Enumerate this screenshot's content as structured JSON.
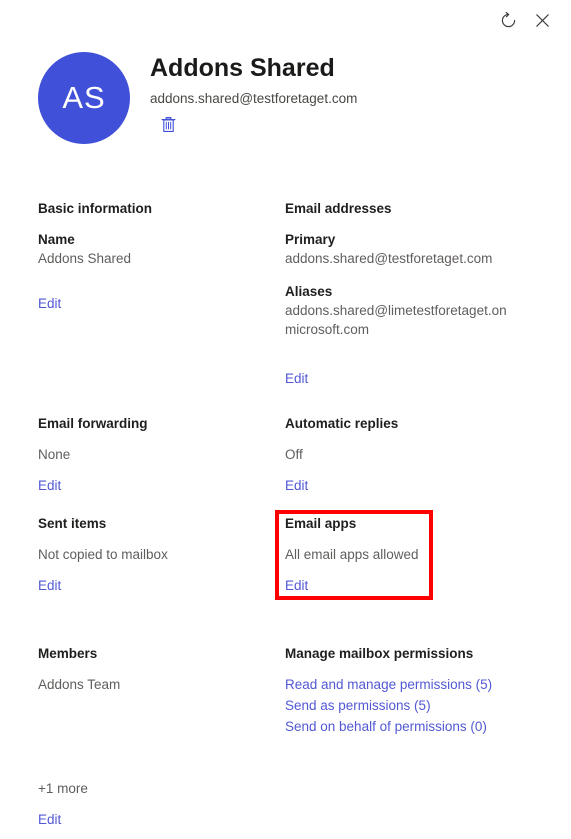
{
  "window": {
    "refresh_tooltip": "Refresh",
    "close_tooltip": "Close"
  },
  "header": {
    "avatar_initials": "AS",
    "display_name": "Addons Shared",
    "primary_email": "addons.shared@testforetaget.com",
    "delete_tooltip": "Delete"
  },
  "sections": {
    "basic_information": {
      "title": "Basic information",
      "name_label": "Name",
      "name_value": "Addons Shared",
      "edit_label": "Edit"
    },
    "email_addresses": {
      "title": "Email addresses",
      "primary_label": "Primary",
      "primary_value": "addons.shared@testforetaget.com",
      "aliases_label": "Aliases",
      "aliases_value_line1": "addons.shared@limetestforetaget.on",
      "aliases_value_line2": "microsoft.com",
      "edit_label": "Edit"
    },
    "email_forwarding": {
      "title": "Email forwarding",
      "value": "None",
      "edit_label": "Edit"
    },
    "automatic_replies": {
      "title": "Automatic replies",
      "value": "Off",
      "edit_label": "Edit"
    },
    "sent_items": {
      "title": "Sent items",
      "value": "Not copied to mailbox",
      "edit_label": "Edit"
    },
    "email_apps": {
      "title": "Email apps",
      "value": "All email apps allowed",
      "edit_label": "Edit",
      "highlight_color": "#ff0000"
    },
    "members": {
      "title": "Members",
      "value": "Addons Team",
      "more_label": "+1 more",
      "edit_label": "Edit"
    },
    "manage_mailbox_permissions": {
      "title": "Manage mailbox permissions",
      "links": [
        "Read and manage permissions (5)",
        "Send as permissions (5)",
        "Send on behalf of permissions (0)"
      ]
    }
  },
  "theme": {
    "avatar_background": "#4150d8",
    "link_color": "#5258d4",
    "label_color": "#201f1e",
    "value_color": "#605e5c",
    "highlight_red": "#ff0000"
  }
}
